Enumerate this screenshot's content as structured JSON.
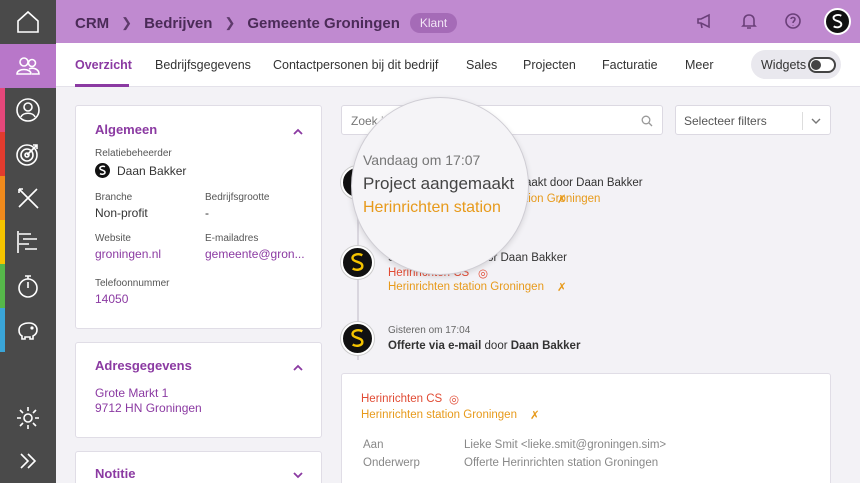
{
  "header": {
    "crumbs": [
      "CRM",
      "Bedrijven",
      "Gemeente Groningen"
    ],
    "badge": "Klant"
  },
  "sidebar": {
    "items": [
      "home-icon",
      "people-icon",
      "person-icon",
      "target-icon",
      "tools-icon",
      "gantt-icon",
      "stopwatch-icon",
      "piggy-bank-icon",
      "gear-icon",
      "expand-icon"
    ],
    "stripe_colors": [
      "#e5477a",
      "#e23b2e",
      "#f08a1c",
      "#f5c400",
      "#56b84a",
      "#3aa5d8",
      "#5c5c5c"
    ]
  },
  "tabs": [
    "Overzicht",
    "Bedrijfsgegevens",
    "Contactpersonen bij dit bedrijf",
    "Sales",
    "Projecten",
    "Facturatie",
    "Meer"
  ],
  "widgets_label": "Widgets",
  "general": {
    "title": "Algemeen",
    "manager_label": "Relatiebeheerder",
    "manager": "Daan Bakker",
    "branch_label": "Branche",
    "branch": "Non-profit",
    "size_label": "Bedrijfsgrootte",
    "size": "-",
    "website_label": "Website",
    "website": "groningen.nl",
    "email_label": "E-mailadres",
    "email": "gemeente@gron...",
    "phone_label": "Telefoonnummer",
    "phone": "14050"
  },
  "address": {
    "title": "Adresgegevens",
    "line1": "Grote Markt 1",
    "line2": "9712 HN Groningen"
  },
  "note": {
    "title": "Notitie"
  },
  "search": {
    "placeholder": "Zoek i"
  },
  "filter": {
    "label": "Selecteer filters"
  },
  "feed": {
    "item1": {
      "by_suffix": "aakt door Daan Bakker",
      "link": "tion Groningen"
    },
    "item2": {
      "title": "Status gewijzigd door Daan Bakker",
      "project_cs": "Herinrichten CS",
      "project": "Herinrichten station Groningen"
    },
    "item3": {
      "time": "Gisteren om 17:04",
      "title_a": "Offerte via e-mail",
      "title_b": " door ",
      "title_c": "Daan Bakker"
    }
  },
  "mail": {
    "project_cs": "Herinrichten CS",
    "project": "Herinrichten station Groningen",
    "to_label": "Aan",
    "to": "Lieke Smit <lieke.smit@groningen.sim>",
    "subject_label": "Onderwerp",
    "subject": "Offerte  Herinrichten station Groningen"
  },
  "magnifier": {
    "time": "Vandaag om 17:07",
    "title": "Project aangemaakt",
    "link": "Herinrichten station"
  },
  "colors": {
    "brand": "#8b3aa2",
    "header": "#c08ad0",
    "orange": "#e79a1b",
    "red": "#e14b34"
  }
}
